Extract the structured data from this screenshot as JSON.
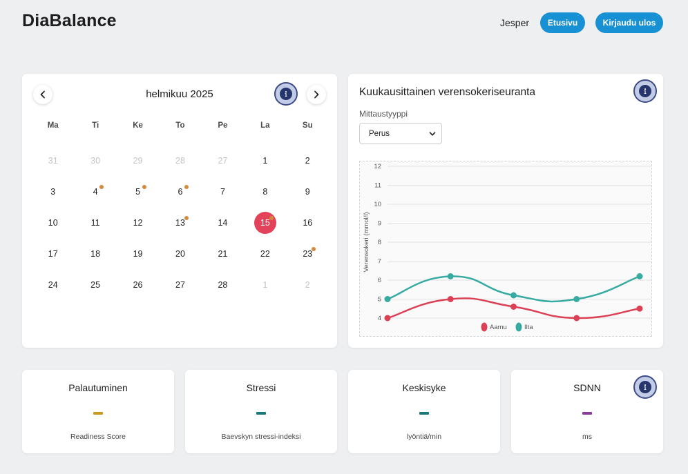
{
  "header": {
    "brand": "DiaBalance",
    "user": "Jesper",
    "home_label": "Etusivu",
    "logout_label": "Kirjaudu ulos",
    "accent": "#1791d4"
  },
  "calendar": {
    "month_label": "helmikuu 2025",
    "weekdays": [
      "Ma",
      "Ti",
      "Ke",
      "To",
      "Pe",
      "La",
      "Su"
    ],
    "days": [
      {
        "n": "31",
        "muted": true
      },
      {
        "n": "30",
        "muted": true
      },
      {
        "n": "29",
        "muted": true
      },
      {
        "n": "28",
        "muted": true
      },
      {
        "n": "27",
        "muted": true
      },
      {
        "n": "1"
      },
      {
        "n": "2"
      },
      {
        "n": "3"
      },
      {
        "n": "4",
        "dot": true
      },
      {
        "n": "5",
        "dot": true
      },
      {
        "n": "6",
        "dot": true
      },
      {
        "n": "7"
      },
      {
        "n": "8"
      },
      {
        "n": "9"
      },
      {
        "n": "10"
      },
      {
        "n": "11"
      },
      {
        "n": "12"
      },
      {
        "n": "13",
        "dot": true
      },
      {
        "n": "14"
      },
      {
        "n": "15",
        "selected": true,
        "dot": true
      },
      {
        "n": "16"
      },
      {
        "n": "17"
      },
      {
        "n": "18"
      },
      {
        "n": "19"
      },
      {
        "n": "20"
      },
      {
        "n": "21"
      },
      {
        "n": "22"
      },
      {
        "n": "23",
        "dot": true
      },
      {
        "n": "24"
      },
      {
        "n": "25"
      },
      {
        "n": "26"
      },
      {
        "n": "27"
      },
      {
        "n": "28"
      },
      {
        "n": "1",
        "muted": true
      },
      {
        "n": "2",
        "muted": true
      }
    ],
    "selected_color": "#e2435b",
    "dot_color": "#d48a3b"
  },
  "glucose": {
    "title": "Kuukausittainen verensokeriseuranta",
    "select_label": "Mittaustyyppi",
    "select_value": "Perus"
  },
  "chart_data": {
    "type": "line",
    "ylabel": "Verensokeri (mmol/l)",
    "ylim": [
      4,
      12
    ],
    "yticks": [
      4,
      5,
      6,
      7,
      8,
      9,
      10,
      11,
      12
    ],
    "grid": true,
    "legend": "bottom",
    "series": [
      {
        "name": "Aamu",
        "values": [
          4.0,
          5.0,
          4.6,
          4.0,
          4.5
        ],
        "color": "#dc4055"
      },
      {
        "name": "Ilta",
        "values": [
          5.0,
          6.2,
          5.2,
          5.0,
          6.2
        ],
        "color": "#35aba2"
      }
    ]
  },
  "metrics": [
    {
      "title": "Palautuminen",
      "value": "–",
      "subtitle": "Readiness Score",
      "color": "#c99a1e"
    },
    {
      "title": "Stressi",
      "value": "–",
      "subtitle": "Baevskyn stressi-indeksi",
      "color": "#17797a"
    },
    {
      "title": "Keskisyke",
      "value": "–",
      "subtitle": "lyöntiä/min",
      "color": "#17797a"
    },
    {
      "title": "SDNN",
      "value": "–",
      "subtitle": "ms",
      "color": "#8a3c99"
    }
  ],
  "icons": {
    "info": "info-icon",
    "prev": "chevron-left-icon",
    "next": "chevron-right-icon",
    "select": "chevron-down-icon"
  }
}
